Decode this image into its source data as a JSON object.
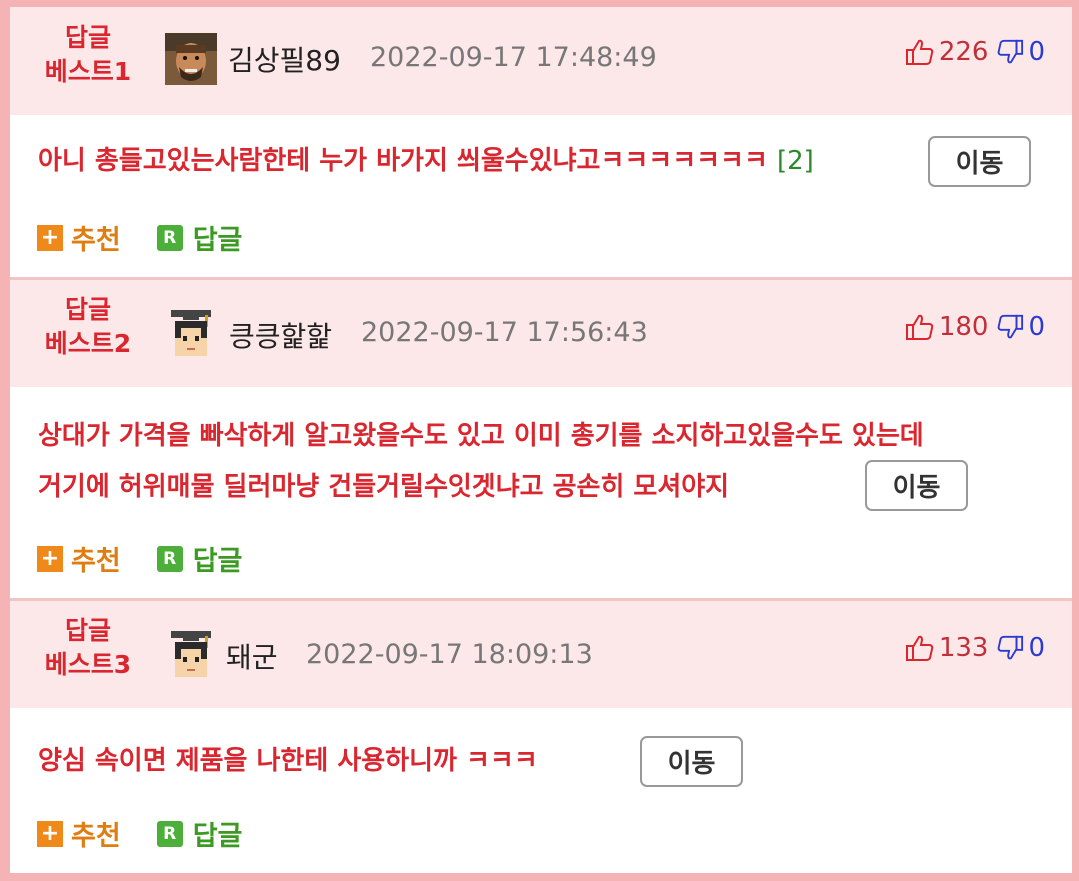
{
  "best_label_top": "답글",
  "comments": [
    {
      "best_label": "베스트1",
      "nickname": "김상필89",
      "date": "2022-09-17 17:48:49",
      "likes": "226",
      "dislikes": "0",
      "lines": [
        "아니 총들고있는사람한테 누가 바가지 씌울수있냐고ㅋㅋㅋㅋㅋㅋㅋ"
      ],
      "reply_count": "[2]"
    },
    {
      "best_label": "베스트2",
      "nickname": "킁킁핥핥",
      "date": "2022-09-17 17:56:43",
      "likes": "180",
      "dislikes": "0",
      "lines": [
        "상대가 가격을 빠삭하게 알고왔을수도 있고 이미 총기를 소지하고있을수도 있는데",
        "거기에 허위매물 딜러마냥 건들거릴수잇겟냐고 공손히 모셔야지"
      ]
    },
    {
      "best_label": "베스트3",
      "nickname": "돼군",
      "date": "2022-09-17 18:09:13",
      "likes": "133",
      "dislikes": "0",
      "lines": [
        "양심 속이면 제품을 나한테 사용하니까 ㅋㅋㅋ"
      ]
    }
  ],
  "move_label": "이동",
  "recommend_icon": "+",
  "recommend_label": "추천",
  "reply_icon": "R",
  "reply_label": "답글",
  "icons": {
    "like": "thumbs-up-icon",
    "dislike": "thumbs-down-icon",
    "avatar1": "warrior-avatar-icon",
    "avatar_default": "graduate-avatar-icon"
  },
  "colors": {
    "accent_red": "#d9262f",
    "header_bg": "#fde8e9",
    "outer_border": "#f5b3b6",
    "recommend_orange": "#ef8a1a",
    "reply_green": "#4caf3a",
    "dislike_blue": "#2a3bd2"
  }
}
